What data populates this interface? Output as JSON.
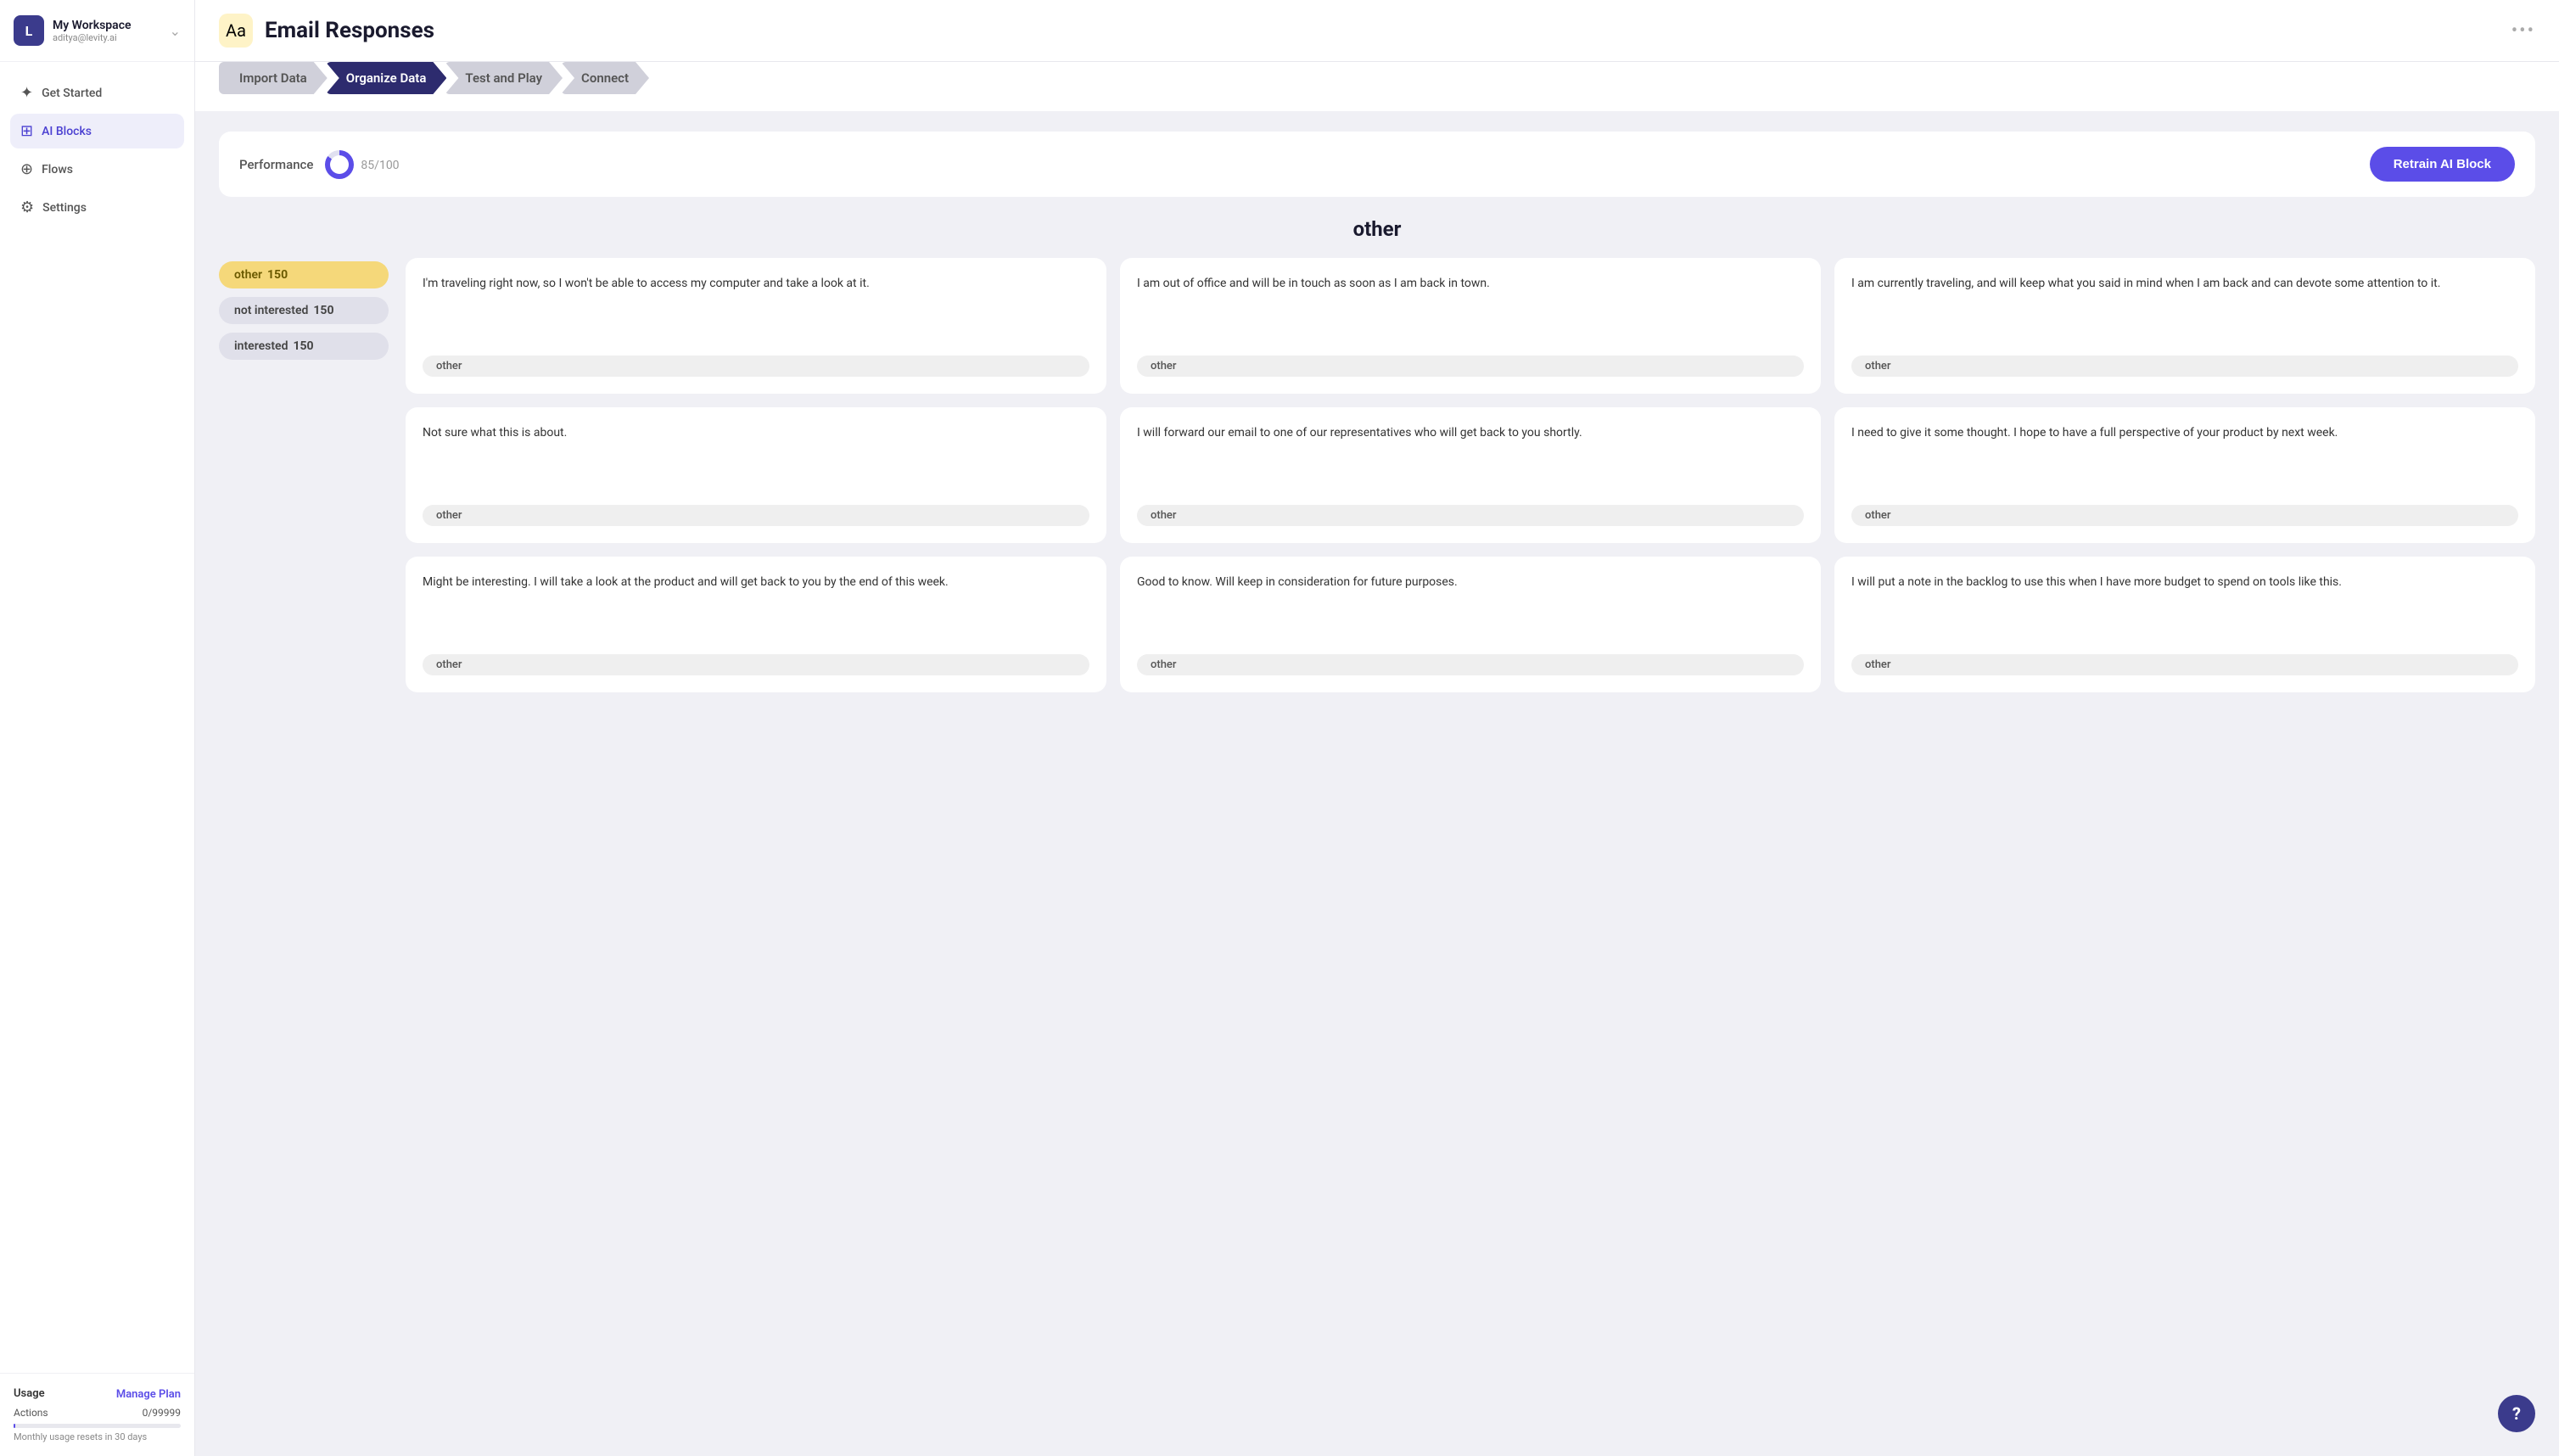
{
  "workspace": {
    "avatar_letter": "L",
    "name": "My Workspace",
    "email": "aditya@levity.ai"
  },
  "sidebar": {
    "nav_items": [
      {
        "id": "get-started",
        "label": "Get Started",
        "icon": "✦",
        "active": false
      },
      {
        "id": "ai-blocks",
        "label": "AI Blocks",
        "icon": "⊞",
        "active": true
      },
      {
        "id": "flows",
        "label": "Flows",
        "icon": "⊕",
        "active": false
      },
      {
        "id": "settings",
        "label": "Settings",
        "icon": "⚙",
        "active": false
      }
    ],
    "usage": {
      "title": "Usage",
      "manage_label": "Manage Plan",
      "actions_label": "Actions",
      "actions_value": "0/99999",
      "reset_text": "Monthly usage resets in 30 days"
    }
  },
  "header": {
    "icon": "Aa",
    "title": "Email Responses",
    "more_icon": "•••"
  },
  "steps": [
    {
      "id": "import-data",
      "label": "Import Data",
      "active": false
    },
    {
      "id": "organize-data",
      "label": "Organize Data",
      "active": true
    },
    {
      "id": "test-and-play",
      "label": "Test and Play",
      "active": false
    },
    {
      "id": "connect",
      "label": "Connect",
      "active": false
    }
  ],
  "performance": {
    "label": "Performance",
    "score": "85",
    "max": "100",
    "retrain_label": "Retrain AI Block"
  },
  "category": {
    "heading": "other",
    "badges": [
      {
        "id": "other",
        "label": "other",
        "count": "150",
        "type": "other"
      },
      {
        "id": "not-interested",
        "label": "not interested",
        "count": "150",
        "type": "not-interested"
      },
      {
        "id": "interested",
        "label": "interested",
        "count": "150",
        "type": "interested"
      }
    ]
  },
  "cards": [
    {
      "text": "I'm traveling right now, so I won't be able to access my computer and take a look at it.",
      "tag": "other"
    },
    {
      "text": "I am out of office and will be in touch as soon as I am back in town.",
      "tag": "other"
    },
    {
      "text": "I am currently traveling, and will keep what you said in mind when I am back and can devote some attention to it.",
      "tag": "other"
    },
    {
      "text": "Not sure what this is about.",
      "tag": "other"
    },
    {
      "text": "I will forward our email to one of our representatives who will get back to you shortly.",
      "tag": "other"
    },
    {
      "text": "I need to give it some thought. I hope to have a full perspective of your product by next week.",
      "tag": "other"
    },
    {
      "text": "Might be interesting. I will take a look at the product and will get back to you by the end of this week.",
      "tag": "other"
    },
    {
      "text": "Good to know. Will keep in consideration for future purposes.",
      "tag": "other"
    },
    {
      "text": "I will put a note in the backlog to use this when I have more budget to spend on tools like this.",
      "tag": "other"
    }
  ],
  "help": {
    "label": "?"
  }
}
